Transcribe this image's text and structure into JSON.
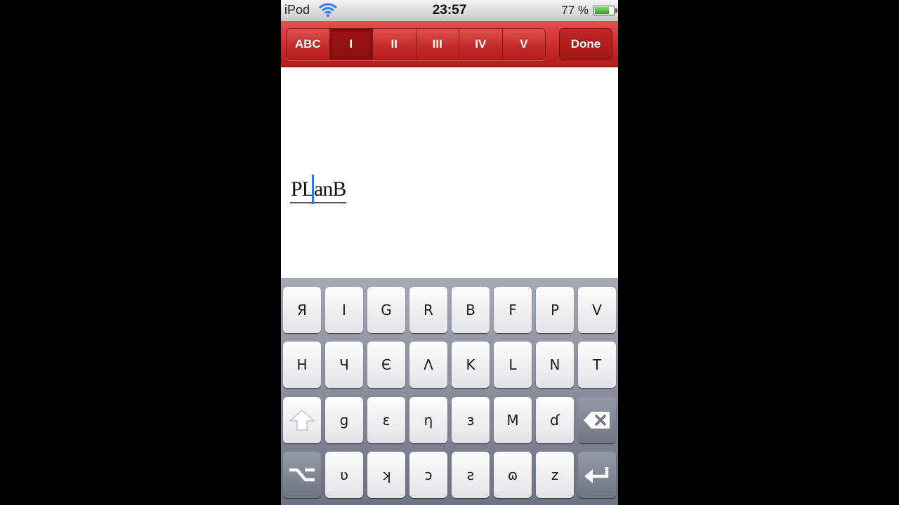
{
  "status_bar": {
    "carrier": "iPod",
    "time": "23:57",
    "battery_percent": "77 %",
    "battery_level": 0.77
  },
  "toolbar": {
    "segments": [
      {
        "label": "ABC",
        "selected": false
      },
      {
        "label": "I",
        "selected": true
      },
      {
        "label": "II",
        "selected": false
      },
      {
        "label": "III",
        "selected": false
      },
      {
        "label": "IV",
        "selected": false
      },
      {
        "label": "V",
        "selected": false
      }
    ],
    "done_label": "Done"
  },
  "editor": {
    "text": "PLanB"
  },
  "keyboard": {
    "row1": [
      "Я",
      "I",
      "G",
      "R",
      "B",
      "F",
      "P",
      "V"
    ],
    "row2": [
      "H",
      "Ч",
      "Є",
      "Λ",
      "K",
      "L",
      "N",
      "T"
    ],
    "row3": [
      "ɡ",
      "ɛ",
      "η",
      "ɜ",
      "M",
      "ɗ"
    ],
    "row4": [
      "ʋ",
      "ʞ",
      "ɔ",
      "ƨ",
      "ɷ",
      "z"
    ]
  }
}
